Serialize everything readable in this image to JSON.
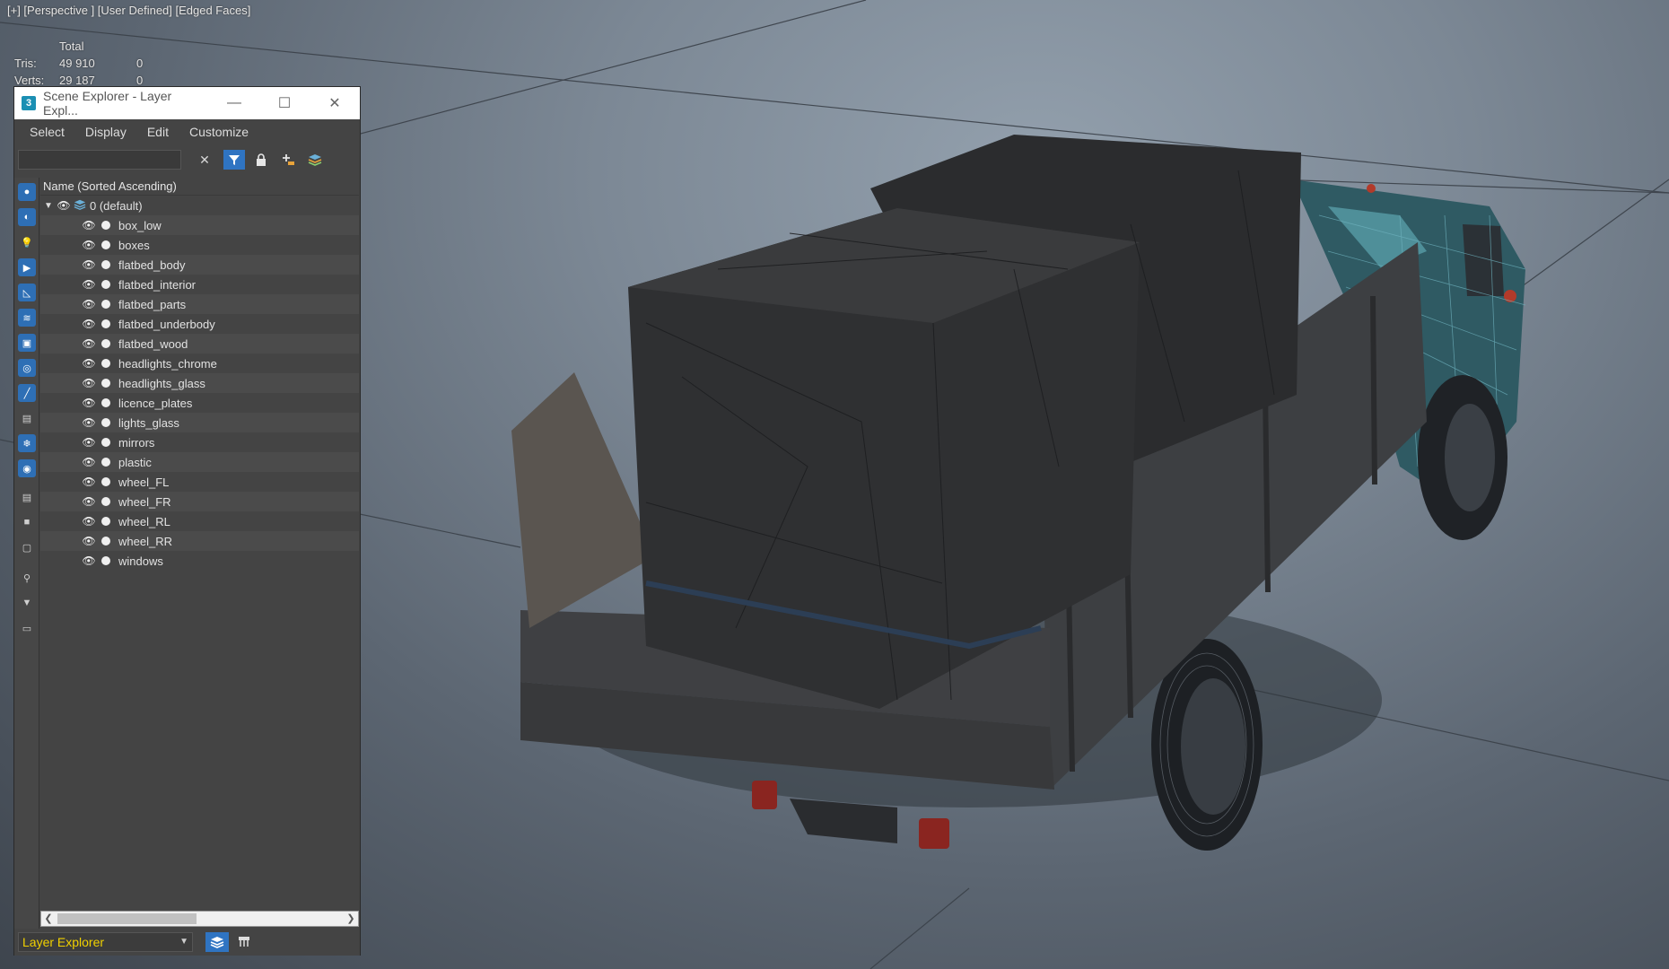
{
  "viewport": {
    "label": "[+] [Perspective ] [User Defined] [Edged Faces]",
    "stats": {
      "header_total": "Total",
      "rows": [
        {
          "label": "Tris:",
          "total": "49 910",
          "selected": "0"
        },
        {
          "label": "Verts:",
          "total": "29 187",
          "selected": "0"
        }
      ]
    }
  },
  "explorer": {
    "title": "Scene Explorer - Layer Expl...",
    "app_icon": "3",
    "window_buttons": {
      "minimize": "—",
      "maximize": "☐",
      "close": "✕"
    },
    "menu": [
      "Select",
      "Display",
      "Edit",
      "Customize"
    ],
    "search": {
      "value": "",
      "placeholder": ""
    },
    "toolbar_icons": [
      "clear-search-icon",
      "filter-icon",
      "lock-icon",
      "add-layer-icon",
      "layers-icon"
    ],
    "column_header": "Name (Sorted Ascending)",
    "layer": {
      "name": "0 (default)"
    },
    "objects": [
      "box_low",
      "boxes",
      "flatbed_body",
      "flatbed_interior",
      "flatbed_parts",
      "flatbed_underbody",
      "flatbed_wood",
      "headlights_chrome",
      "headlights_glass",
      "licence_plates",
      "lights_glass",
      "mirrors",
      "plastic",
      "wheel_FL",
      "wheel_FR",
      "wheel_RL",
      "wheel_RR",
      "windows"
    ],
    "explorer_type": "Layer Explorer"
  },
  "colors": {
    "accent": "#2f74c2",
    "panel": "#444444",
    "explorer_type_text": "#f0d000"
  }
}
